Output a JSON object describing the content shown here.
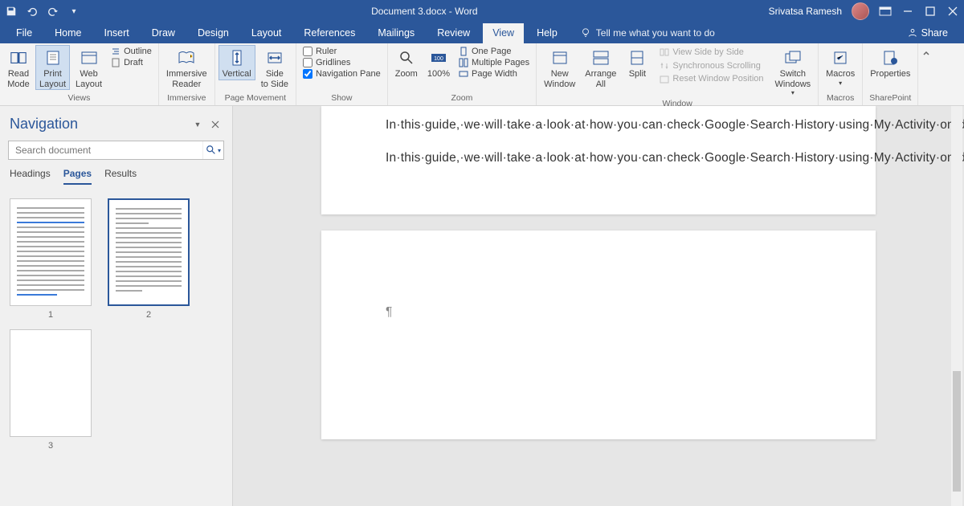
{
  "title_bar": {
    "doc_title": "Document 3.docx  -  Word",
    "user_name": "Srivatsa Ramesh"
  },
  "menu": {
    "items": [
      "File",
      "Home",
      "Insert",
      "Draw",
      "Design",
      "Layout",
      "References",
      "Mailings",
      "Review",
      "View",
      "Help"
    ],
    "active": "View",
    "tell_me": "Tell me what you want to do",
    "share": "Share"
  },
  "ribbon": {
    "views": {
      "label": "Views",
      "read_mode": "Read\nMode",
      "print_layout": "Print\nLayout",
      "web_layout": "Web\nLayout",
      "outline": "Outline",
      "draft": "Draft"
    },
    "immersive": {
      "label": "Immersive",
      "reader": "Immersive\nReader"
    },
    "page_movement": {
      "label": "Page Movement",
      "vertical": "Vertical",
      "side": "Side\nto Side"
    },
    "show": {
      "label": "Show",
      "ruler": "Ruler",
      "gridlines": "Gridlines",
      "nav_pane": "Navigation Pane",
      "nav_checked": true
    },
    "zoom": {
      "label": "Zoom",
      "zoom": "Zoom",
      "pct": "100%",
      "one_page": "One Page",
      "multiple": "Multiple Pages",
      "page_width": "Page Width"
    },
    "window": {
      "label": "Window",
      "new": "New\nWindow",
      "arrange": "Arrange\nAll",
      "split": "Split",
      "side_by_side": "View Side by Side",
      "sync": "Synchronous Scrolling",
      "reset": "Reset Window Position",
      "switch": "Switch\nWindows"
    },
    "macros": {
      "label": "Macros",
      "macros": "Macros"
    },
    "sharepoint": {
      "label": "SharePoint",
      "properties": "Properties"
    }
  },
  "nav": {
    "title": "Navigation",
    "search_placeholder": "Search document",
    "tabs": {
      "headings": "Headings",
      "pages": "Pages",
      "results": "Results"
    },
    "active_tab": "Pages",
    "pages": [
      "1",
      "2",
      "3"
    ],
    "selected_page": "2"
  },
  "document": {
    "para1": "In·this·guide,·we·will·take·a·look·at·how·you·can·check·Google·Search·History·using·My·Activity·on·different·devices·like·Android,·iPhone/iPad,·and·computers.·Apart·from·checking·the·activities,·we·have·also·mentioned·how·you·can·get·more·details·of·the·activity·and·also·how·you·can·turn·off·this·feature·so·your·activities·are·not·tracked.\\¶",
    "para2": "In·this·guide,·we·will·take·a·look·at·how·you·can·check·Google·Search·History·using·My·Activity·on·different·devices·like·Android,·iPhone/iPad,·and·computers.·Apart·from·checking·the·activities,·we·have·also·mentioned·how·you·can·get·not·tracked.\\¶",
    "para3": "¶"
  }
}
